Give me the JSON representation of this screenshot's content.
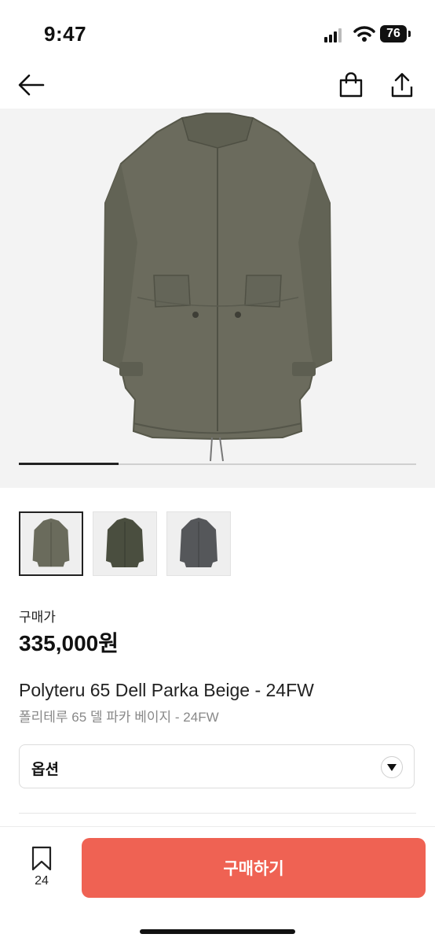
{
  "status_bar": {
    "time": "9:47",
    "battery": "76",
    "icons": [
      "signal-icon",
      "wifi-icon",
      "battery-icon"
    ]
  },
  "nav": {
    "icons": [
      "back-arrow-icon",
      "shopping-bag-icon",
      "share-icon"
    ]
  },
  "gallery": {
    "progress": 0.25,
    "thumbnails": [
      {
        "color": "#6a6b5c",
        "selected": true
      },
      {
        "color": "#4a4e3f",
        "selected": false
      },
      {
        "color": "#55575a",
        "selected": false
      }
    ]
  },
  "product": {
    "price_label": "구매가",
    "price": "335,000원",
    "name_en": "Polyteru 65 Dell Parka Beige - 24FW",
    "name_ko": "폴리테루 65 델 파카 베이지 - 24FW"
  },
  "option": {
    "label": "옵션",
    "icon": "dropdown-triangle-icon"
  },
  "bottom_bar": {
    "wish_icon": "bookmark-icon",
    "wish_count": "24",
    "buy_label": "구매하기",
    "buy_color": "#ef6253"
  }
}
